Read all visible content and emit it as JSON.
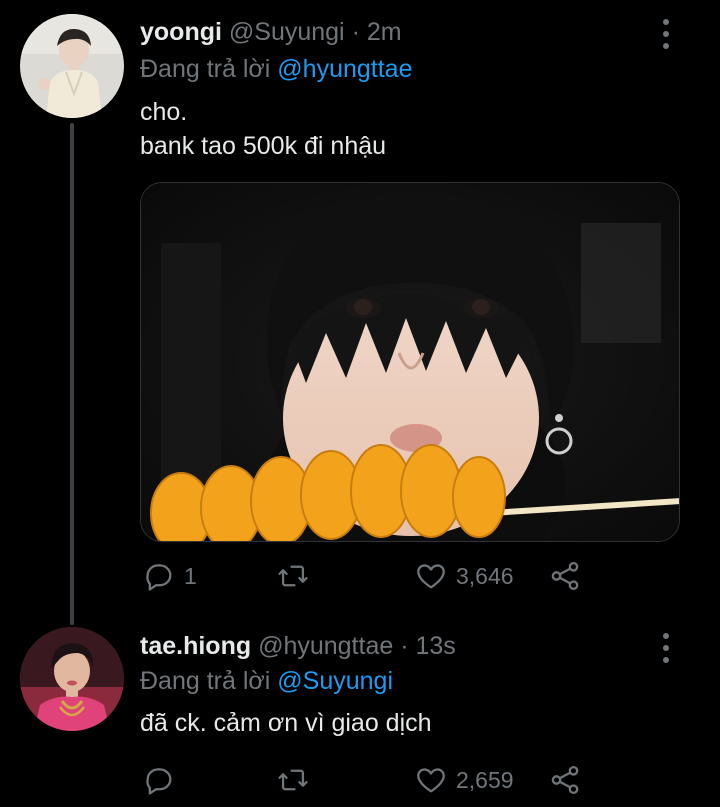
{
  "tweets": [
    {
      "display_name": "yoongi",
      "handle": "@Suyungi",
      "separator": "·",
      "time": "2m",
      "reply_prefix": "Đang trả lời",
      "reply_mention": "@hyungttae",
      "text": "cho.\nbank tao 500k đi nhậu",
      "has_media": true,
      "reply_count": "1",
      "retweet_count": "",
      "like_count": "3,646"
    },
    {
      "display_name": "tae.hiong",
      "handle": "@hyungttae",
      "separator": "·",
      "time": "13s",
      "reply_prefix": "Đang trả lời",
      "reply_mention": "@Suyungi",
      "text": "đã ck. cảm ơn vì giao dịch",
      "has_media": false,
      "reply_count": "",
      "retweet_count": "",
      "like_count": "2,659"
    }
  ],
  "icons": {
    "reply": "reply-icon",
    "retweet": "retweet-icon",
    "like": "heart-icon",
    "share": "share-icon",
    "more": "more-icon"
  },
  "colors": {
    "background": "#000000",
    "text": "#e7e9ea",
    "muted": "#71767b",
    "link": "#1d9bf0",
    "thread_line": "#3e4144"
  }
}
